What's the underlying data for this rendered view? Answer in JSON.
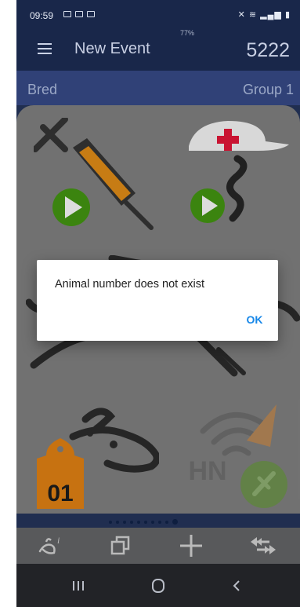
{
  "status_bar": {
    "time": "09:59",
    "notification_icons": [
      "gallery-icon",
      "message-icon",
      "app-icon"
    ],
    "right_icons": [
      "mute-icon",
      "wifi-icon",
      "signal-icon",
      "battery-icon"
    ]
  },
  "app_bar": {
    "title": "New Event",
    "battery_percent": "77%",
    "animal_number": "5222"
  },
  "sub_bar": {
    "left": "Bred",
    "right": "Group 1"
  },
  "tiles": [
    {
      "name": "vaccinate-tile",
      "icon": "syringe-icon",
      "badge": "play-icon"
    },
    {
      "name": "health-tile",
      "icon": "vet-cap-icon",
      "badge": "play-icon"
    },
    {
      "name": "left-middle-tile",
      "icon": "animal-outline-icon"
    },
    {
      "name": "right-middle-tile",
      "icon": "tool-icon"
    },
    {
      "name": "ear-tag-tile",
      "icon": "animal-head-icon",
      "tag_text": "01"
    },
    {
      "name": "hn-tile",
      "icon": "rfid-reader-icon",
      "text": "HN"
    }
  ],
  "pager": {
    "count": 10,
    "active": 9
  },
  "bottom_toolbar": [
    "animal-info-icon",
    "copy-icon",
    "add-icon",
    "transfer-icon"
  ],
  "nav_bar": [
    "recent-apps-icon",
    "home-icon",
    "back-icon"
  ],
  "dialog": {
    "message": "Animal number does not exist",
    "ok_label": "OK"
  },
  "colors": {
    "app_bar": "#152347",
    "sub_bar": "#2c3e75",
    "accent": "#1787e8",
    "play_green": "#38820b",
    "tag_orange": "#c6700d",
    "syringe_orange": "#c67a10",
    "cross_red": "#c8102e"
  }
}
